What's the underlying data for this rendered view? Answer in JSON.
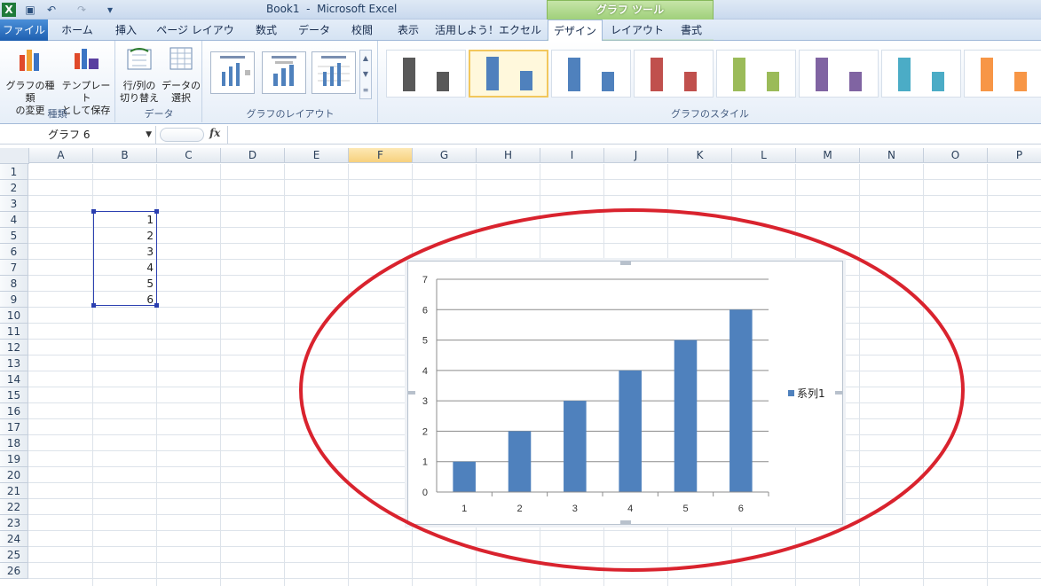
{
  "title": "Book1  -  Microsoft Excel",
  "contextual_tab": "グラフ ツール",
  "tabs": [
    "ファイル",
    "ホーム",
    "挿入",
    "ページ レイアウト",
    "数式",
    "データ",
    "校閲",
    "表示",
    "活用しよう！エクセル",
    "デザイン",
    "レイアウト",
    "書式"
  ],
  "ribbon": {
    "type_group": {
      "label": "種類",
      "change_type": "グラフの種類\nの変更",
      "save_template": "テンプレート\nとして保存"
    },
    "data_group": {
      "label": "データ",
      "switch_rowcol": "行/列の\n切り替え",
      "select_data": "データの\n選択"
    },
    "layout_group": {
      "label": "グラフのレイアウト"
    },
    "style_group": {
      "label": "グラフのスタイル",
      "style_colors": [
        "#595959",
        "#4f81bd",
        "#4f81bd",
        "#c0504d",
        "#9bbb59",
        "#8064a2",
        "#4bacc6",
        "#f79646"
      ]
    }
  },
  "formula_bar": {
    "name_box": "グラフ 6",
    "fx": "fx",
    "content": ""
  },
  "columns": [
    "A",
    "B",
    "C",
    "D",
    "E",
    "F",
    "G",
    "H",
    "I",
    "J",
    "K",
    "L",
    "M",
    "N",
    "O",
    "P"
  ],
  "rows": [
    "1",
    "2",
    "3",
    "4",
    "5",
    "6",
    "7",
    "8",
    "9",
    "10",
    "11",
    "12",
    "13",
    "14",
    "15",
    "16",
    "17",
    "18",
    "19",
    "20",
    "21",
    "22",
    "23",
    "24",
    "25",
    "26"
  ],
  "cells": {
    "B4": "1",
    "B5": "2",
    "B6": "3",
    "B7": "4",
    "B8": "5",
    "B9": "6"
  },
  "annotation_color": "#d9232e",
  "chart_data": {
    "type": "bar",
    "categories": [
      "1",
      "2",
      "3",
      "4",
      "5",
      "6"
    ],
    "series": [
      {
        "name": "系列1",
        "values": [
          1,
          2,
          3,
          4,
          5,
          6
        ],
        "color": "#4f81bd"
      }
    ],
    "yticks": [
      "0",
      "1",
      "2",
      "3",
      "4",
      "5",
      "6",
      "7"
    ],
    "ylim": [
      0,
      7
    ],
    "grid": true,
    "legend": "right"
  }
}
